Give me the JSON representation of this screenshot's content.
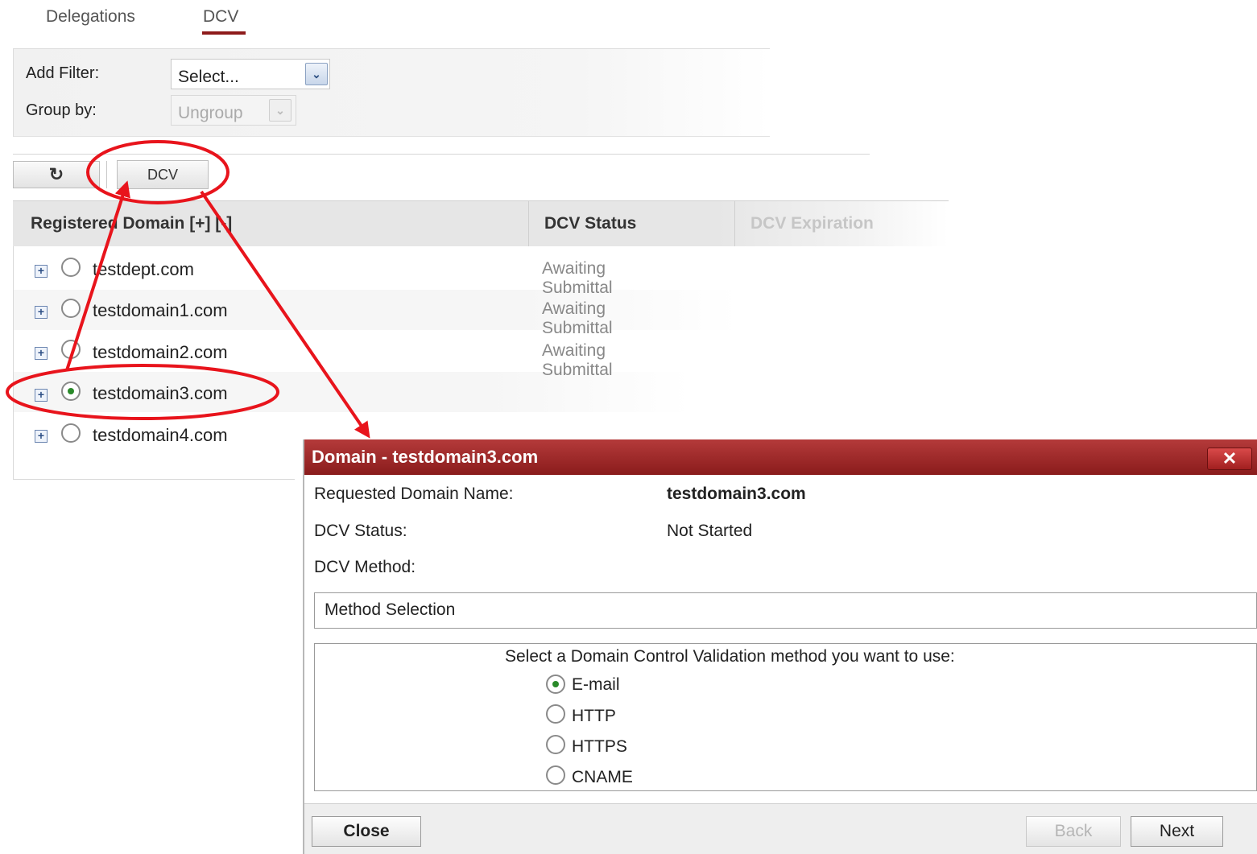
{
  "tabs": [
    {
      "label": "Delegations",
      "active": false
    },
    {
      "label": "DCV",
      "active": true
    }
  ],
  "filters": {
    "add_filter_label": "Add Filter:",
    "add_filter_value": "Select...",
    "group_by_label": "Group by:",
    "group_by_value": "Ungroup"
  },
  "toolbar": {
    "refresh_icon": "refresh-icon",
    "dcv_label": "DCV"
  },
  "grid": {
    "columns": [
      "Registered Domain [+] [-]",
      "DCV Status",
      "DCV Expiration"
    ],
    "rows": [
      {
        "domain": "testdept.com",
        "status": "Awaiting Submittal",
        "selected": false
      },
      {
        "domain": "testdomain1.com",
        "status": "Awaiting Submittal",
        "selected": false
      },
      {
        "domain": "testdomain2.com",
        "status": "Awaiting Submittal",
        "selected": false
      },
      {
        "domain": "testdomain3.com",
        "status": "",
        "selected": true
      },
      {
        "domain": "testdomain4.com",
        "status": "",
        "selected": false
      }
    ]
  },
  "dialog": {
    "title": "Domain - testdomain3.com",
    "close_icon": "close-icon",
    "requested_label": "Requested Domain Name:",
    "requested_value": "testdomain3.com",
    "status_label": "DCV Status:",
    "status_value": "Not Started",
    "method_label": "DCV Method:",
    "method_section_title": "Method Selection",
    "method_prompt": "Select a Domain Control Validation method you want to use:",
    "methods": [
      {
        "label": "E-mail",
        "selected": true
      },
      {
        "label": "HTTP",
        "selected": false
      },
      {
        "label": "HTTPS",
        "selected": false
      },
      {
        "label": "CNAME",
        "selected": false
      }
    ],
    "buttons": {
      "close": "Close",
      "back": "Back",
      "next": "Next"
    }
  },
  "colors": {
    "accent": "#8e1b1b",
    "annotation": "#e8141c",
    "radio_selected": "#2a8a2a"
  }
}
